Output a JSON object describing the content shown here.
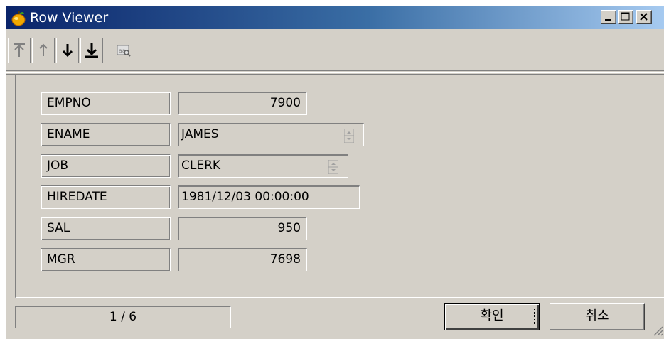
{
  "window": {
    "title": "Row Viewer"
  },
  "toolbar": {
    "buttons": [
      {
        "name": "first-record",
        "icon": "arrow-to-top-icon",
        "enabled": false
      },
      {
        "name": "previous-record",
        "icon": "arrow-up-icon",
        "enabled": false
      },
      {
        "name": "next-record",
        "icon": "arrow-down-icon",
        "enabled": true
      },
      {
        "name": "last-record",
        "icon": "arrow-to-bottom-icon",
        "enabled": true
      },
      {
        "name": "find",
        "icon": "find-icon",
        "enabled": false
      }
    ]
  },
  "fields": [
    {
      "label": "EMPNO",
      "value": "7900",
      "align": "right"
    },
    {
      "label": "ENAME",
      "value": "JAMES",
      "align": "left",
      "spinner": true
    },
    {
      "label": "JOB",
      "value": "CLERK",
      "align": "left",
      "spinner": true
    },
    {
      "label": "HIREDATE",
      "value": "1981/12/03 00:00:00",
      "align": "left"
    },
    {
      "label": "SAL",
      "value": "950",
      "align": "right"
    },
    {
      "label": "MGR",
      "value": "7698",
      "align": "right"
    }
  ],
  "status": {
    "position": "1 / 6"
  },
  "buttons": {
    "ok_label": "확인",
    "cancel_label": "취소"
  },
  "colors": {
    "face": "#d4d0c8",
    "title_start": "#0a246a",
    "title_end": "#a6caf0"
  }
}
